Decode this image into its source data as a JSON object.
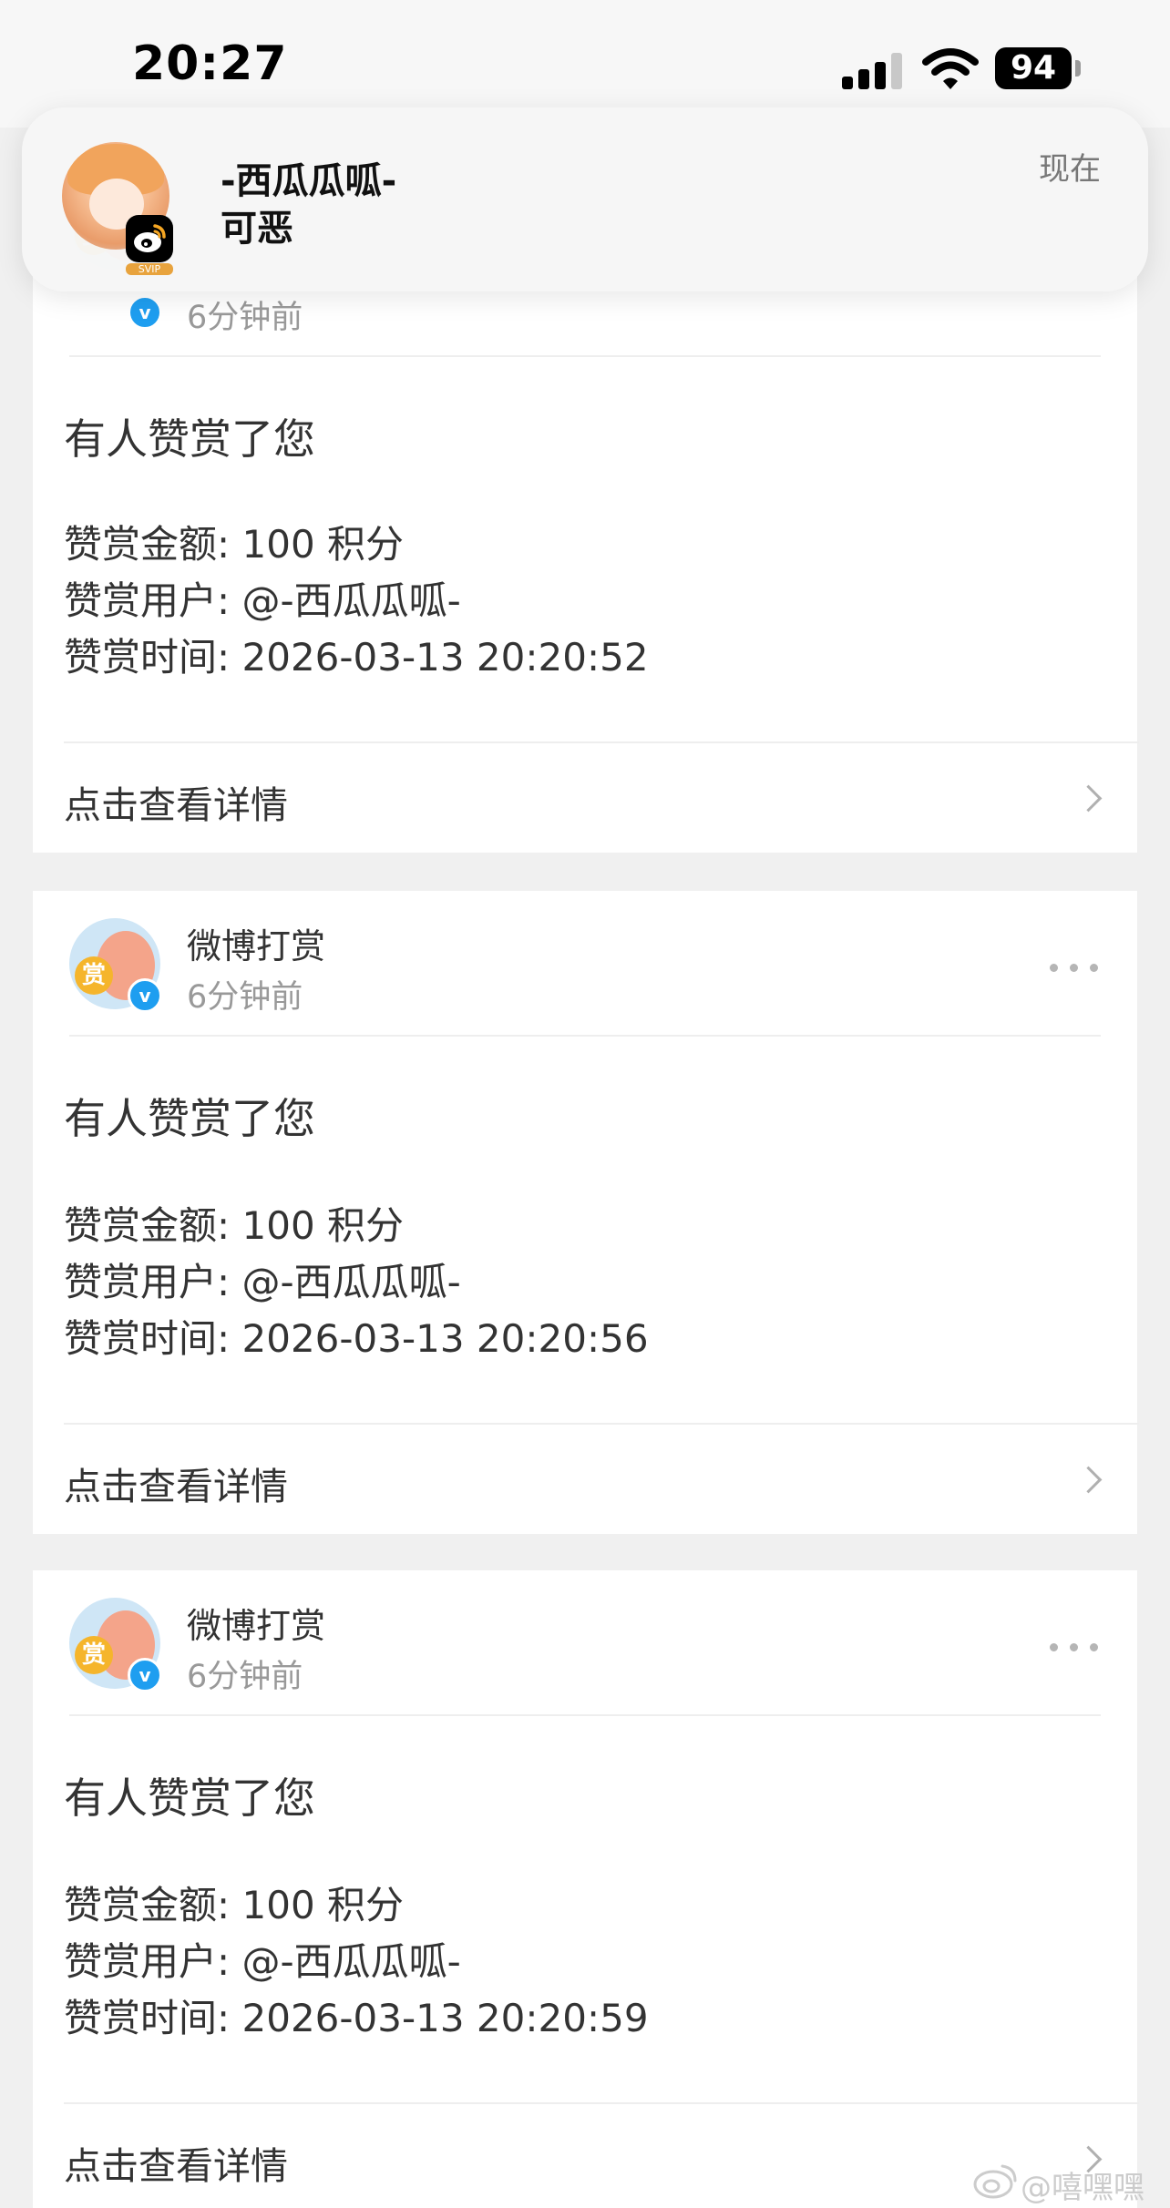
{
  "status_bar": {
    "time": "20:27",
    "battery": "94"
  },
  "notification": {
    "sender": "-西瓜瓜呱-",
    "message": "可恶",
    "time": "现在",
    "badge": "SVIP"
  },
  "cards": [
    {
      "sender": "",
      "ago": "6分钟前",
      "headline": "有人赞赏了您",
      "amount": "赞赏金额: 100 积分",
      "user": "赞赏用户: @-西瓜瓜呱-",
      "time": "赞赏时间: 2026-03-13 20:20:52",
      "cta": "点击查看详情"
    },
    {
      "sender": "微博打赏",
      "ago": "6分钟前",
      "headline": "有人赞赏了您",
      "amount": "赞赏金额: 100 积分",
      "user": "赞赏用户: @-西瓜瓜呱-",
      "time": "赞赏时间: 2026-03-13 20:20:56",
      "cta": "点击查看详情"
    },
    {
      "sender": "微博打赏",
      "ago": "6分钟前",
      "headline": "有人赞赏了您",
      "amount": "赞赏金额: 100 积分",
      "user": "赞赏用户: @-西瓜瓜呱-",
      "time": "赞赏时间: 2026-03-13 20:20:59",
      "cta": "点击查看详情"
    }
  ],
  "avatar_tag": "赏",
  "verified_mark": "v",
  "watermark": "@嘻嘿嘿",
  "icons": [
    "signal-icon",
    "wifi-icon",
    "battery-icon",
    "weibo-icon",
    "verified-icon",
    "more-icon",
    "chevron-right-icon"
  ],
  "colors": {
    "background": "#f0f0f0",
    "card": "#ffffff",
    "verified_blue": "#1e9ef0",
    "muted_text": "#999999"
  }
}
